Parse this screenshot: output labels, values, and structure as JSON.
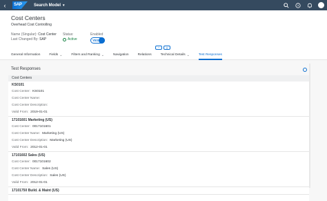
{
  "shell": {
    "logo": "SAP",
    "app_title": "Search Model",
    "caret": "▾",
    "back": "‹",
    "icons": [
      "search-icon",
      "help-icon",
      "bell-icon",
      "avatar"
    ]
  },
  "header": {
    "title": "Cost Centers",
    "subtitle": "Overhead Cost Controlling",
    "name_label": "Name (Singular):",
    "name_value": "Cost Center",
    "changed_label": "Last Changed By:",
    "changed_value": "SAP",
    "status_label": "Status:",
    "status_value": "Active",
    "enabled_label": "Enabled",
    "toggle_text": "YES",
    "collapse_up": "⌃",
    "collapse_pin": "⇕"
  },
  "tabs": [
    {
      "label": "General Information",
      "has_menu": false
    },
    {
      "label": "Fields",
      "has_menu": true
    },
    {
      "label": "Filters and Ranking",
      "has_menu": true
    },
    {
      "label": "Navigation",
      "has_menu": false
    },
    {
      "label": "Relations",
      "has_menu": false
    },
    {
      "label": "Technical Details",
      "has_menu": true
    },
    {
      "label": "Test Responses",
      "has_menu": false
    }
  ],
  "chev": "⌄",
  "section": {
    "title": "Test Responses",
    "table_header": "Cost Centers"
  },
  "records": [
    {
      "title": "KS0101",
      "fields": [
        {
          "k": "Cost Center:",
          "v": "KS0101"
        },
        {
          "k": "Cost Center Name:",
          "v": ""
        },
        {
          "k": "Cost Center Description:",
          "v": ""
        },
        {
          "k": "Valid From:",
          "v": "2019-01-01"
        }
      ]
    },
    {
      "title": "17101601 Marketing (US)",
      "fields": [
        {
          "k": "Cost Center:",
          "v": "0017101601"
        },
        {
          "k": "Cost Center Name:",
          "v": "Marketing (US)"
        },
        {
          "k": "Cost Center Description:",
          "v": "Marketing (US)"
        },
        {
          "k": "Valid From:",
          "v": "2012-01-01"
        }
      ]
    },
    {
      "title": "17101602 Sales (US)",
      "fields": [
        {
          "k": "Cost Center:",
          "v": "0017101602"
        },
        {
          "k": "Cost Center Name:",
          "v": "Sales (US)"
        },
        {
          "k": "Cost Center Description:",
          "v": "Sales (US)"
        },
        {
          "k": "Valid From:",
          "v": "2012-01-01"
        }
      ]
    },
    {
      "title": "17101750 Build. & Maint (US)",
      "fields": []
    }
  ]
}
